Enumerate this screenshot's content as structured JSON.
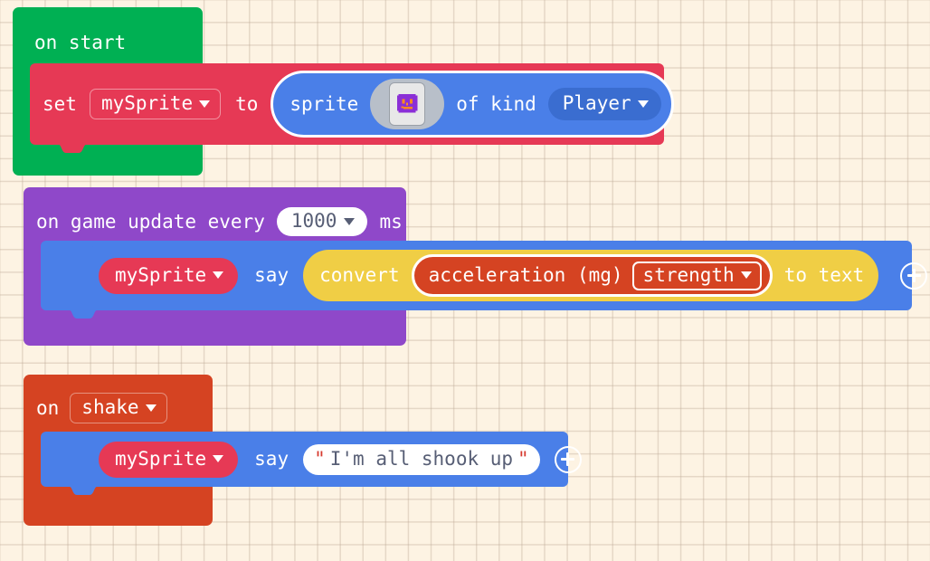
{
  "app": {
    "name": "makecode-arcade-blocks-workspace",
    "background_color": "#fdf3e3",
    "grid_line_color": "#beaa96"
  },
  "colors": {
    "event_green": "#00b053",
    "variables_red": "#e63955",
    "sprites_blue": "#4a7fe8",
    "loops_purple": "#8f48c9",
    "text_yellow": "#f0ce45",
    "controller_orange": "#d54322",
    "kind_dropdown_blue": "#3a6dd0",
    "field_white": "#ffffff",
    "field_text_dark": "#575e75",
    "quote_red": "#d63a2f"
  },
  "scripts": [
    {
      "id": "on-start",
      "event_label": "on start",
      "statements": [
        {
          "id": "set-variable",
          "prefix_label": "set",
          "variable": {
            "value": "mySprite",
            "type": "dropdown"
          },
          "middle_label": "to",
          "value_block": {
            "id": "sprite-of-kind",
            "prefix_label": "sprite",
            "image_field": {
              "name": "sprite-image",
              "description": "purple square face with orange eyes and mouth"
            },
            "middle_label": "of kind",
            "kind": {
              "value": "Player",
              "type": "dropdown"
            },
            "selected": true
          }
        }
      ]
    },
    {
      "id": "on-game-update-every",
      "event_label_parts": {
        "before": "on game update every",
        "after": "ms"
      },
      "interval": {
        "value": "1000",
        "type": "dropdown"
      },
      "statements": [
        {
          "id": "sprite-say",
          "target": {
            "value": "mySprite",
            "type": "dropdown"
          },
          "verb_label": "say",
          "value_block": {
            "id": "convert-to-text",
            "prefix_label": "convert",
            "suffix_label": "to text",
            "inner_block": {
              "id": "acceleration",
              "label": "acceleration (mg)",
              "axis": {
                "value": "strength",
                "type": "dropdown"
              }
            }
          },
          "mutation_button": "plus-icon"
        }
      ]
    },
    {
      "id": "on-shake",
      "event_prefix_label": "on",
      "gesture": {
        "value": "shake",
        "type": "dropdown"
      },
      "statements": [
        {
          "id": "sprite-say-text",
          "target": {
            "value": "mySprite",
            "type": "dropdown"
          },
          "verb_label": "say",
          "text_value": "I'm all shook up",
          "quote_open": "\"",
          "quote_close": "\"",
          "mutation_button": "plus-icon"
        }
      ]
    }
  ]
}
